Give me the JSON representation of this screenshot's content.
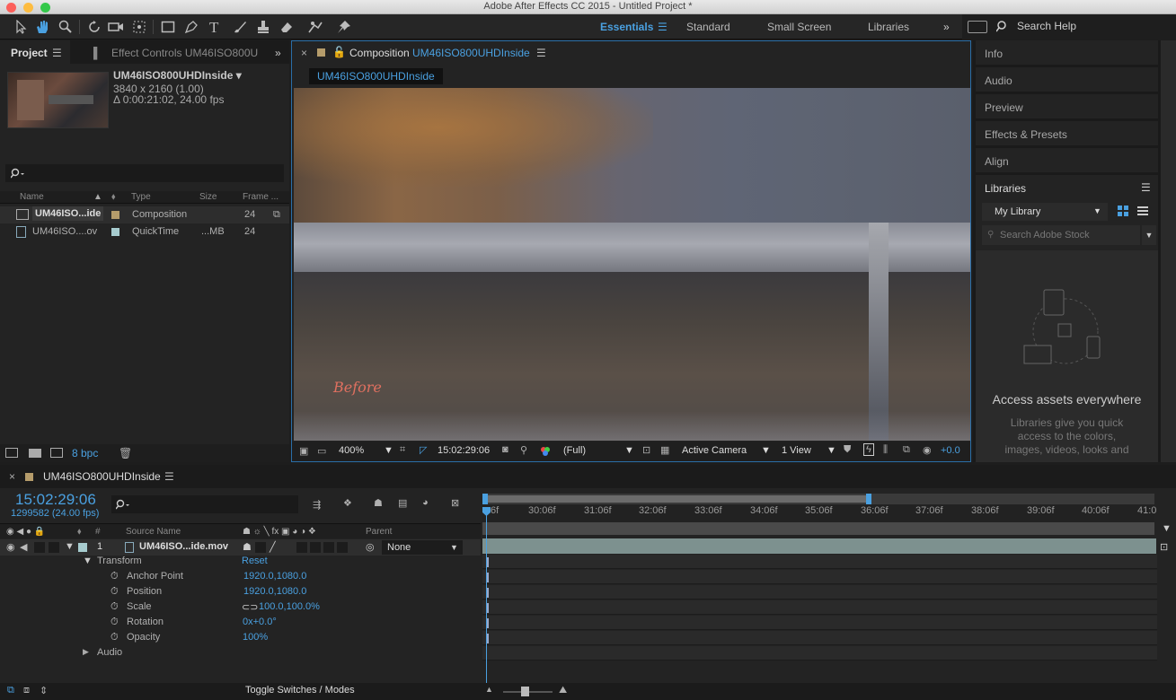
{
  "window": {
    "title": "Adobe After Effects CC 2015 - Untitled Project *"
  },
  "workspaces": {
    "items": [
      "Essentials",
      "Standard",
      "Small Screen",
      "Libraries"
    ],
    "more": "»",
    "search_help": "Search Help"
  },
  "project_panel": {
    "tab_label": "Project",
    "effect_controls_tab": "Effect Controls UM46ISO800U",
    "item_name": "UM46ISO800UHDInside ▾",
    "item_size": "3840 x 2160 (1.00)",
    "item_duration": "Δ 0:00:21:02, 24.00 fps",
    "search_icon": "search-icon",
    "columns": {
      "name": "Name",
      "type": "Type",
      "size": "Size",
      "frame": "Frame ..."
    },
    "rows": [
      {
        "name": "UM46ISO...ide",
        "type": "Composition",
        "size": "",
        "frame": "24"
      },
      {
        "name": "UM46ISO....ov",
        "type": "QuickTime",
        "size": "...MB",
        "frame": "24"
      }
    ],
    "bpc": "8 bpc"
  },
  "composition_panel": {
    "tab_prefix": "Composition",
    "tab_name": "UM46ISO800UHDInside",
    "comp_chip": "UM46ISO800UHDInside",
    "overlay_text": "Before",
    "footer": {
      "zoom": "400%",
      "timecode": "15:02:29:06",
      "resolution": "(Full)",
      "camera": "Active Camera",
      "views": "1 View",
      "exposure": "+0.0"
    }
  },
  "right_panel": {
    "items": [
      "Info",
      "Audio",
      "Preview",
      "Effects & Presets",
      "Align"
    ],
    "libraries": {
      "title": "Libraries",
      "library_select": "My Library",
      "search_placeholder": "Search Adobe Stock",
      "headline": "Access assets everywhere",
      "body_line1": "Libraries give you quick",
      "body_line2": "access to the colors,",
      "body_line3": "images, videos, looks and"
    }
  },
  "timeline": {
    "comp_name": "UM46ISO800UHDInside",
    "timecode": "15:02:29:06",
    "frame_info": "1299582 (24.00 fps)",
    "columns": {
      "hash": "#",
      "source_name": "Source Name",
      "parent": "Parent"
    },
    "layer": {
      "index": "1",
      "name": "UM46ISO...ide.mov",
      "parent": "None"
    },
    "transform": {
      "label": "Transform",
      "reset": "Reset"
    },
    "properties": [
      {
        "name": "Anchor Point",
        "value": "1920.0,1080.0"
      },
      {
        "name": "Position",
        "value": "1920.0,1080.0"
      },
      {
        "name": "Scale",
        "value": "100.0,100.0%"
      },
      {
        "name": "Rotation",
        "value": "0x+0.0°"
      },
      {
        "name": "Opacity",
        "value": "100%"
      }
    ],
    "audio_label": "Audio",
    "ruler_ticks": [
      "6f",
      "30:06f",
      "31:06f",
      "32:06f",
      "33:06f",
      "34:06f",
      "35:06f",
      "36:06f",
      "37:06f",
      "38:06f",
      "39:06f",
      "40:06f",
      "41:0"
    ],
    "toggle_label": "Toggle Switches / Modes"
  }
}
